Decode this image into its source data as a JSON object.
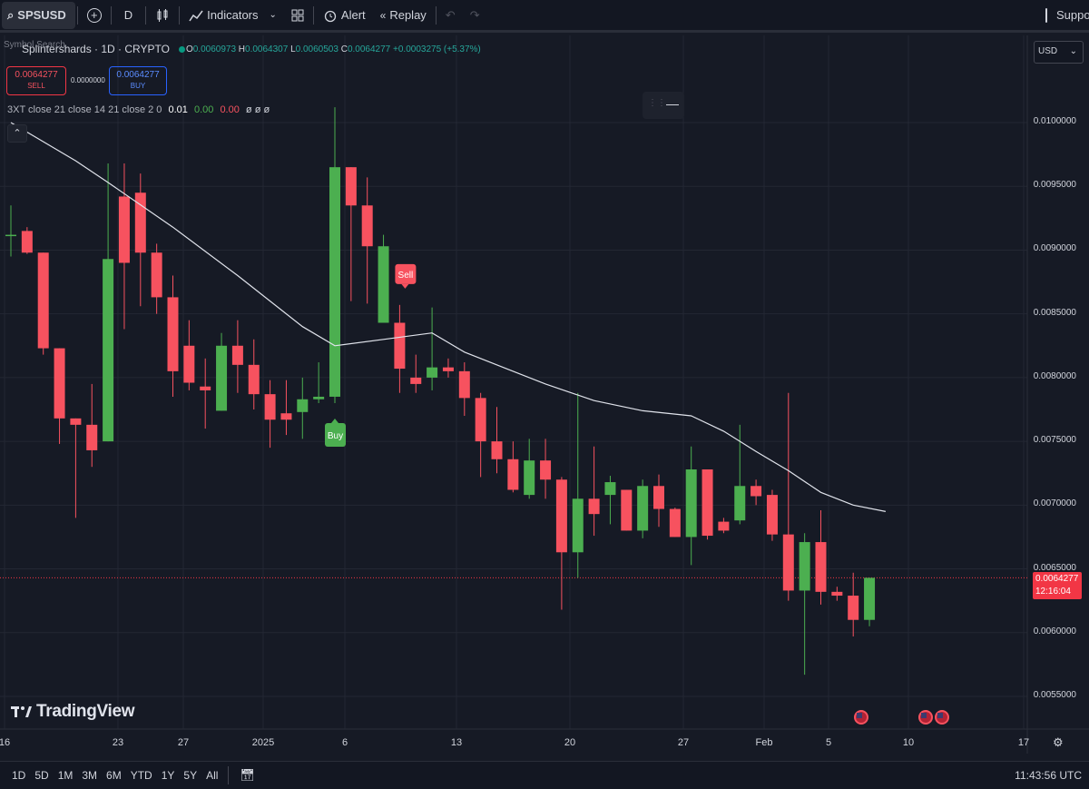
{
  "toolbar": {
    "symbol": "SPSUSD",
    "interval": "D",
    "indicators_label": "Indicators",
    "alert_label": "Alert",
    "replay_label": "Replay",
    "support_label": "Suppo"
  },
  "legend": {
    "search_placeholder": "Symbol Search",
    "title": "Splintershards · 1D · CRYPTO",
    "open_key": "O",
    "open": "0.0060973",
    "high_key": "H",
    "high": "0.0064307",
    "low_key": "L",
    "low": "0.0060503",
    "close_key": "C",
    "close": "0.0064277",
    "change": "+0.0003275 (+5.37%)"
  },
  "trade": {
    "sell_price": "0.0064277",
    "sell_label": "SELL",
    "spread": "0.0000000",
    "buy_price": "0.0064277",
    "buy_label": "BUY"
  },
  "indicator": {
    "name": "3XT close 21 close 14 21 close 2 0",
    "v1": "0.01",
    "v2": "0.00",
    "v3": "0.00",
    "v4": "ø ø ø"
  },
  "price_axis": {
    "currency": "USD",
    "labels": [
      "0.0100000",
      "0.0095000",
      "0.0090000",
      "0.0085000",
      "0.0080000",
      "0.0075000",
      "0.0070000",
      "0.0065000",
      "0.0060000",
      "0.0055000"
    ],
    "current_price": "0.0064277",
    "countdown": "12:16:04"
  },
  "time_axis": {
    "labels": [
      "16",
      "23",
      "27",
      "2025",
      "6",
      "13",
      "20",
      "27",
      "Feb",
      "5",
      "10",
      "17"
    ]
  },
  "markers": {
    "buy": "Buy",
    "sell": "Sell"
  },
  "brand": "TradingView",
  "bottom": {
    "ranges": [
      "1D",
      "5D",
      "1M",
      "3M",
      "6M",
      "YTD",
      "1Y",
      "5Y",
      "All"
    ],
    "clock": "11:43:56 UTC"
  },
  "colors": {
    "up": "#4caf50",
    "down": "#f7525f",
    "ma": "#e0e3eb",
    "bg": "#161a25"
  },
  "chart_data": {
    "type": "candlestick",
    "ylim": [
      0.0052,
      0.0104
    ],
    "candles": [
      {
        "o": 0.00912,
        "h": 0.00935,
        "l": 0.00895,
        "c": 0.00912
      },
      {
        "o": 0.00915,
        "h": 0.00918,
        "l": 0.00897,
        "c": 0.00898
      },
      {
        "o": 0.00898,
        "h": 0.00898,
        "l": 0.00818,
        "c": 0.00823
      },
      {
        "o": 0.00823,
        "h": 0.00823,
        "l": 0.00748,
        "c": 0.00768
      },
      {
        "o": 0.00768,
        "h": 0.00768,
        "l": 0.0069,
        "c": 0.00763
      },
      {
        "o": 0.00763,
        "h": 0.00795,
        "l": 0.0073,
        "c": 0.00743
      },
      {
        "o": 0.0075,
        "h": 0.00968,
        "l": 0.0075,
        "c": 0.00893
      },
      {
        "o": 0.00942,
        "h": 0.00968,
        "l": 0.00838,
        "c": 0.0089
      },
      {
        "o": 0.00945,
        "h": 0.0096,
        "l": 0.00856,
        "c": 0.00898
      },
      {
        "o": 0.00898,
        "h": 0.00905,
        "l": 0.0085,
        "c": 0.00863
      },
      {
        "o": 0.00863,
        "h": 0.0088,
        "l": 0.00785,
        "c": 0.00805
      },
      {
        "o": 0.00825,
        "h": 0.00845,
        "l": 0.0079,
        "c": 0.00796
      },
      {
        "o": 0.00793,
        "h": 0.00815,
        "l": 0.0076,
        "c": 0.0079
      },
      {
        "o": 0.00774,
        "h": 0.00835,
        "l": 0.00774,
        "c": 0.00825
      },
      {
        "o": 0.00825,
        "h": 0.00845,
        "l": 0.00788,
        "c": 0.0081
      },
      {
        "o": 0.0081,
        "h": 0.0083,
        "l": 0.00775,
        "c": 0.00787
      },
      {
        "o": 0.00787,
        "h": 0.00798,
        "l": 0.00745,
        "c": 0.00767
      },
      {
        "o": 0.00772,
        "h": 0.00798,
        "l": 0.00755,
        "c": 0.00767
      },
      {
        "o": 0.00773,
        "h": 0.008,
        "l": 0.00752,
        "c": 0.00783
      },
      {
        "o": 0.00783,
        "h": 0.00812,
        "l": 0.0078,
        "c": 0.00785
      },
      {
        "o": 0.00785,
        "h": 0.01012,
        "l": 0.0078,
        "c": 0.00965
      },
      {
        "o": 0.00965,
        "h": 0.00965,
        "l": 0.0086,
        "c": 0.00935
      },
      {
        "o": 0.00935,
        "h": 0.00957,
        "l": 0.00858,
        "c": 0.00903
      },
      {
        "o": 0.00843,
        "h": 0.00912,
        "l": 0.00843,
        "c": 0.00903
      },
      {
        "o": 0.00843,
        "h": 0.00857,
        "l": 0.00788,
        "c": 0.00807
      },
      {
        "o": 0.008,
        "h": 0.00818,
        "l": 0.00788,
        "c": 0.00795
      },
      {
        "o": 0.008,
        "h": 0.00855,
        "l": 0.0079,
        "c": 0.00808
      },
      {
        "o": 0.00808,
        "h": 0.00815,
        "l": 0.008,
        "c": 0.00805
      },
      {
        "o": 0.00805,
        "h": 0.00812,
        "l": 0.0077,
        "c": 0.00784
      },
      {
        "o": 0.00784,
        "h": 0.00788,
        "l": 0.00722,
        "c": 0.0075
      },
      {
        "o": 0.0075,
        "h": 0.00777,
        "l": 0.00725,
        "c": 0.00736
      },
      {
        "o": 0.00736,
        "h": 0.0075,
        "l": 0.0071,
        "c": 0.00712
      },
      {
        "o": 0.00708,
        "h": 0.00752,
        "l": 0.00705,
        "c": 0.00735
      },
      {
        "o": 0.00735,
        "h": 0.00752,
        "l": 0.00705,
        "c": 0.0072
      },
      {
        "o": 0.0072,
        "h": 0.00722,
        "l": 0.00618,
        "c": 0.00663
      },
      {
        "o": 0.00663,
        "h": 0.00788,
        "l": 0.00643,
        "c": 0.00705
      },
      {
        "o": 0.00705,
        "h": 0.00746,
        "l": 0.00676,
        "c": 0.00693
      },
      {
        "o": 0.00708,
        "h": 0.00723,
        "l": 0.00685,
        "c": 0.00718
      },
      {
        "o": 0.00712,
        "h": 0.00712,
        "l": 0.0068,
        "c": 0.0068
      },
      {
        "o": 0.0068,
        "h": 0.0072,
        "l": 0.00674,
        "c": 0.00715
      },
      {
        "o": 0.00715,
        "h": 0.00724,
        "l": 0.00683,
        "c": 0.00697
      },
      {
        "o": 0.00697,
        "h": 0.00698,
        "l": 0.00675,
        "c": 0.00675
      },
      {
        "o": 0.00675,
        "h": 0.00746,
        "l": 0.00653,
        "c": 0.00728
      },
      {
        "o": 0.00728,
        "h": 0.00728,
        "l": 0.00673,
        "c": 0.00676
      },
      {
        "o": 0.00687,
        "h": 0.0069,
        "l": 0.00678,
        "c": 0.0068
      },
      {
        "o": 0.00688,
        "h": 0.00763,
        "l": 0.00685,
        "c": 0.00715
      },
      {
        "o": 0.00715,
        "h": 0.0072,
        "l": 0.007,
        "c": 0.00707
      },
      {
        "o": 0.00708,
        "h": 0.00712,
        "l": 0.00672,
        "c": 0.00677
      },
      {
        "o": 0.00677,
        "h": 0.00788,
        "l": 0.00625,
        "c": 0.00633
      },
      {
        "o": 0.00633,
        "h": 0.00678,
        "l": 0.00567,
        "c": 0.00671
      },
      {
        "o": 0.00671,
        "h": 0.00696,
        "l": 0.00622,
        "c": 0.00632
      },
      {
        "o": 0.00632,
        "h": 0.00636,
        "l": 0.00625,
        "c": 0.00629
      },
      {
        "o": 0.00629,
        "h": 0.00647,
        "l": 0.00597,
        "c": 0.0061
      },
      {
        "o": 0.0061,
        "h": 0.00643,
        "l": 0.00605,
        "c": 0.00643
      }
    ],
    "ma_points": [
      [
        0,
        0.01
      ],
      [
        4,
        0.0097
      ],
      [
        6,
        0.00953
      ],
      [
        10,
        0.00918
      ],
      [
        14,
        0.0088
      ],
      [
        18,
        0.0084
      ],
      [
        20,
        0.00825
      ],
      [
        23,
        0.0083
      ],
      [
        26,
        0.00835
      ],
      [
        28,
        0.0082
      ],
      [
        31,
        0.00805
      ],
      [
        33,
        0.00795
      ],
      [
        36,
        0.00782
      ],
      [
        39,
        0.00774
      ],
      [
        42,
        0.0077
      ],
      [
        44,
        0.00758
      ],
      [
        46,
        0.00742
      ],
      [
        48,
        0.00727
      ],
      [
        50,
        0.0071
      ],
      [
        52,
        0.007
      ],
      [
        54,
        0.00695
      ]
    ],
    "buy_index": 20,
    "sell_index": 24
  }
}
